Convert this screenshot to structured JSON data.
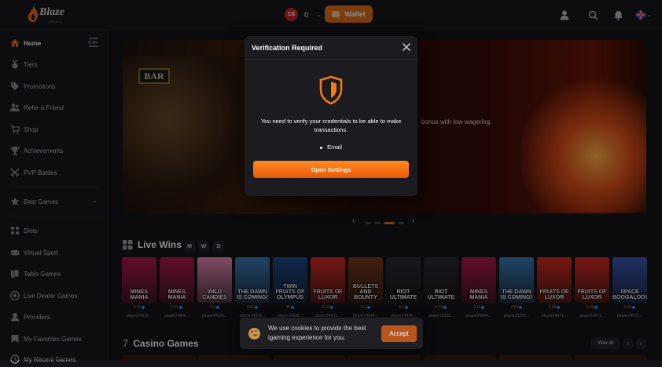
{
  "header": {
    "logo_text": "Blaze",
    "logo_sub": "SPINS",
    "currency_badge": "C$",
    "balance": "0",
    "wallet_label": "Wallet"
  },
  "sidebar": {
    "items": [
      {
        "label": "Home",
        "icon": "home-icon",
        "active": true
      },
      {
        "label": "Tiers",
        "icon": "medal-icon"
      },
      {
        "label": "Promotions",
        "icon": "tag-icon"
      },
      {
        "label": "Refer a Friend",
        "icon": "users-icon"
      },
      {
        "label": "Shop",
        "icon": "cart-icon"
      },
      {
        "label": "Achievements",
        "icon": "trophy-icon"
      },
      {
        "label": "PVP Battles",
        "icon": "swords-icon"
      },
      {
        "label": "Best Games",
        "icon": "star-icon"
      },
      {
        "label": "Slots",
        "icon": "slots-icon"
      },
      {
        "label": "Virtual Sport",
        "icon": "gamepad-icon"
      },
      {
        "label": "Table Games",
        "icon": "cards-icon"
      },
      {
        "label": "Live Dealer Games",
        "icon": "chip-icon"
      },
      {
        "label": "Providers",
        "icon": "provider-icon"
      },
      {
        "label": "My Favorites Games",
        "icon": "heart-icon"
      },
      {
        "label": "My Recent Games",
        "icon": "clock-icon"
      }
    ]
  },
  "banner": {
    "text": "bonus with low wagering."
  },
  "live_wins": {
    "title": "Live Wins",
    "tabs": [
      "M",
      "W",
      "D"
    ],
    "cards": [
      {
        "title": "MINES MANIA",
        "amount": "0.11",
        "player": "player24222...",
        "color": "#b01a4a"
      },
      {
        "title": "MINES MANIA",
        "amount": "0.11",
        "player": "player24844...",
        "color": "#b01a4a"
      },
      {
        "title": "WILD CANDIES",
        "amount": "0.2",
        "player": "player24934...",
        "color": "#e88ab8"
      },
      {
        "title": "THE DAWN IS COMING!",
        "amount": "0.52",
        "player": "player24868...",
        "color": "#3a7ab8"
      },
      {
        "title": "TWIN FRUITS OF OLYMPUS",
        "amount": "96",
        "player": "player24848...",
        "color": "#1e4a8a"
      },
      {
        "title": "FRUITS OF LUXOR",
        "amount": "0.84",
        "player": "player24931...",
        "color": "#d82a20"
      },
      {
        "title": "BULLETS AND BOUNTY",
        "amount": "0.2",
        "player": "player24844...",
        "color": "#7a3a1a"
      },
      {
        "title": "RIOT ULTIMATE",
        "amount": "0.1",
        "player": "player24844...",
        "color": "#2a2a34"
      },
      {
        "title": "RIOT ULTIMATE",
        "amount": "0.03",
        "player": "player22233...",
        "color": "#2a2a34"
      },
      {
        "title": "MINES MANIA",
        "amount": "0.11",
        "player": "player24844...",
        "color": "#b01a4a"
      },
      {
        "title": "THE DAWN IS COMING!",
        "amount": "2.09",
        "player": "player16382...",
        "color": "#3a7ab8"
      },
      {
        "title": "FRUITS OF LUXOR",
        "amount": "2.98",
        "player": "player24971...",
        "color": "#d82a20"
      },
      {
        "title": "FRUITS OF LUXOR",
        "amount": "0.09",
        "player": "player24971...",
        "color": "#d82a20"
      },
      {
        "title": "SPACE BOOGALOOS",
        "amount": "0.30",
        "player": "player24970...",
        "color": "#3a5ab8"
      }
    ]
  },
  "casino_games": {
    "title": "Casino Games",
    "view_all": "View all"
  },
  "modal": {
    "title": "Verification Required",
    "message": "You need to verify your credentials to be able to make transactions.",
    "list_item": "Email",
    "button": "Open Settings"
  },
  "cookie": {
    "text": "We use cookies to provide the best igaming experience for you.",
    "accept": "Accept"
  },
  "colors": {
    "accent": "#e06e1a",
    "background": "#141418"
  }
}
